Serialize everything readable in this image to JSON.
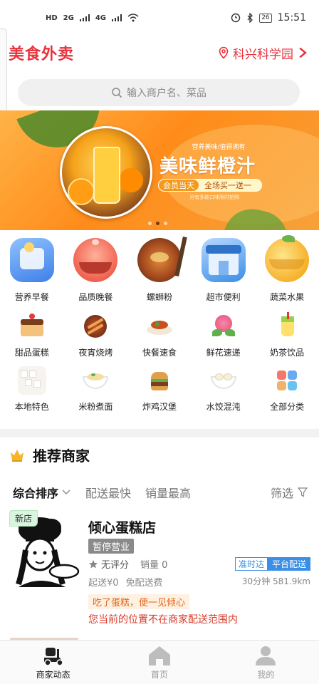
{
  "status_bar": {
    "left_labels": [
      "HD",
      "2G",
      "4G"
    ],
    "battery": "26",
    "time": "15:51"
  },
  "header": {
    "title": "美食外卖",
    "location": "科兴科学园"
  },
  "search": {
    "placeholder": "输入商户名、菜品"
  },
  "banner": {
    "subtitle": "营养美味/值得拥有",
    "title": "美味鲜橙汁",
    "pill_left": "会员当天",
    "pill_right": "全场买一送一",
    "note": "另有多款口味限时抢购",
    "dots_total": 3,
    "dots_active_index": 1
  },
  "categories": {
    "row1": [
      {
        "label": "营养早餐",
        "icon": "breakfast-icon",
        "color": "#4a8ef0"
      },
      {
        "label": "品质晚餐",
        "icon": "dinner-icon",
        "color": "#f06a5a"
      },
      {
        "label": "螺蛳粉",
        "icon": "snail-noodle-icon",
        "color": "#c8602a"
      },
      {
        "label": "超市便利",
        "icon": "supermarket-icon",
        "color": "#3a8ee6"
      },
      {
        "label": "蔬菜水果",
        "icon": "fruit-icon",
        "color": "#f5b12a"
      }
    ],
    "row2": [
      {
        "label": "甜品蛋糕",
        "icon": "cake-icon"
      },
      {
        "label": "夜宵烧烤",
        "icon": "bbq-icon"
      },
      {
        "label": "快餐速食",
        "icon": "fast-food-icon"
      },
      {
        "label": "鲜花速递",
        "icon": "flower-icon"
      },
      {
        "label": "奶茶饮品",
        "icon": "milk-tea-icon"
      }
    ],
    "row3": [
      {
        "label": "本地特色",
        "icon": "local-food-icon"
      },
      {
        "label": "米粉煮面",
        "icon": "rice-noodle-icon"
      },
      {
        "label": "炸鸡汉堡",
        "icon": "burger-icon"
      },
      {
        "label": "水饺混沌",
        "icon": "dumpling-icon"
      },
      {
        "label": "全部分类",
        "icon": "all-categories-icon"
      }
    ]
  },
  "recommend": {
    "title": "推荐商家",
    "sort": {
      "active": "综合排序",
      "fastest": "配送最快",
      "top_sales": "销量最高",
      "filter": "筛选"
    }
  },
  "shop": {
    "new_badge": "新店",
    "name": "倾心蛋糕店",
    "status": "暂停营业",
    "rating": "无评分",
    "sales": "销量 0",
    "tag_on_time": "准时达",
    "tag_platform": "平台配送",
    "delivery_start": "起送¥0",
    "delivery_fee": "免配送费",
    "distance": "30分钟 581.9km",
    "promo": "吃了蛋糕，便一见倾心",
    "warning": "您当前的位置不在商家配送范围内"
  },
  "bottom_nav": {
    "items": [
      {
        "label": "商家动态",
        "icon": "scooter-icon",
        "active": true
      },
      {
        "label": "首页",
        "icon": "home-icon",
        "active": false
      },
      {
        "label": "我的",
        "icon": "profile-icon",
        "active": false
      }
    ]
  },
  "colors": {
    "brand_red": "#e8323c",
    "tag_blue": "#3a8ee6",
    "promo_orange": "#e0651a"
  }
}
